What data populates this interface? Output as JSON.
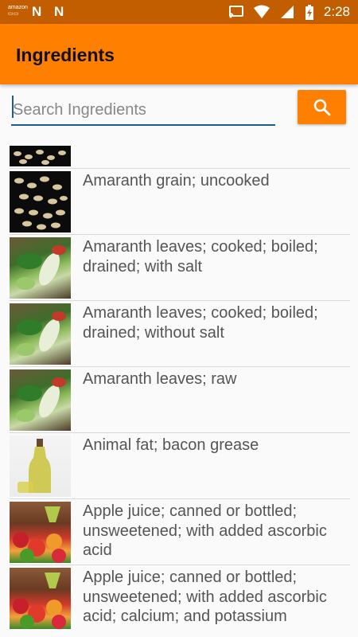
{
  "status_bar": {
    "time": "2:28",
    "left_icons": [
      "amazon-icon",
      "n-icon",
      "n-icon"
    ],
    "right_icons": [
      "cast-icon",
      "wifi-icon",
      "signal-icon",
      "battery-charging-icon"
    ]
  },
  "app_bar": {
    "title": "Ingredients",
    "color": "#ff8000"
  },
  "search": {
    "placeholder": "Search Ingredients",
    "value": "",
    "button_icon": "search-icon"
  },
  "ingredients": [
    {
      "name": "",
      "thumb": "grain"
    },
    {
      "name": "Amaranth grain; uncooked",
      "thumb": "grain"
    },
    {
      "name": "Amaranth leaves; cooked; boiled; drained; with salt",
      "thumb": "greens"
    },
    {
      "name": "Amaranth leaves; cooked; boiled; drained; without salt",
      "thumb": "greens"
    },
    {
      "name": "Amaranth leaves; raw",
      "thumb": "greens"
    },
    {
      "name": "Animal fat; bacon grease",
      "thumb": "oil"
    },
    {
      "name": "Apple juice; canned or bottled; unsweetened; with added ascorbic acid",
      "thumb": "fruit"
    },
    {
      "name": "Apple juice; canned or bottled; unsweetened; with added ascorbic acid; calcium; and potassium",
      "thumb": "fruit"
    }
  ]
}
